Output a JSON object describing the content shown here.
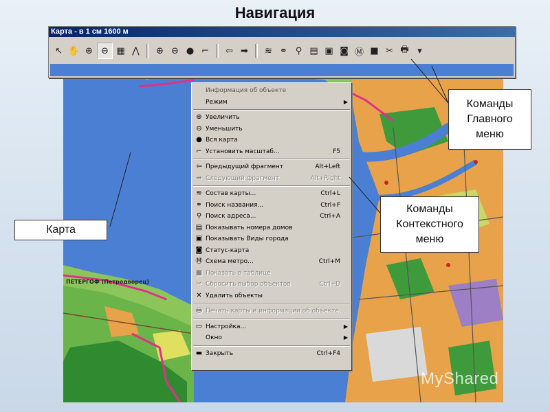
{
  "slide_title": "Навигация",
  "window": {
    "title": "Карта - в 1 см 1600 м"
  },
  "toolbar": {
    "buttons": [
      {
        "icon": "arrow-pointer-icon",
        "glyph": "↖"
      },
      {
        "icon": "hand-pan-icon",
        "glyph": "✋"
      },
      {
        "icon": "zoom-in-icon",
        "glyph": "⊕"
      },
      {
        "icon": "zoom-out-icon",
        "glyph": "⊖"
      },
      {
        "icon": "train-icon",
        "glyph": "▦"
      },
      {
        "icon": "compass-icon",
        "glyph": "⋀"
      },
      {
        "icon": "plus-circle-icon",
        "glyph": "⊕"
      },
      {
        "icon": "minus-circle-icon",
        "glyph": "⊖"
      },
      {
        "icon": "globe-icon",
        "glyph": "●"
      },
      {
        "icon": "scale-ruler-icon",
        "glyph": "⌐"
      },
      {
        "icon": "back-arrow-icon",
        "glyph": "⇦"
      },
      {
        "icon": "forward-arrow-icon",
        "glyph": "➡"
      },
      {
        "icon": "layers-icon",
        "glyph": "≋"
      },
      {
        "icon": "binoculars-icon",
        "glyph": "⚭"
      },
      {
        "icon": "address-search-icon",
        "glyph": "⚲"
      },
      {
        "icon": "house-numbers-icon",
        "glyph": "▤"
      },
      {
        "icon": "camera-icon",
        "glyph": "▣"
      },
      {
        "icon": "status-map-icon",
        "glyph": "◙"
      },
      {
        "icon": "metro-icon",
        "glyph": "Ⓜ"
      },
      {
        "icon": "table-icon",
        "glyph": "■"
      },
      {
        "icon": "deselect-icon",
        "glyph": "✂"
      },
      {
        "icon": "print-icon",
        "glyph": "🖶"
      },
      {
        "icon": "dropdown-arrow-icon",
        "glyph": "▾"
      }
    ]
  },
  "context_menu": {
    "items": [
      {
        "type": "item",
        "label": "Информация об объекте",
        "icon": "",
        "shortcut": "",
        "state": "header"
      },
      {
        "type": "item",
        "label": "Режим",
        "icon": "",
        "shortcut": "",
        "submenu": true
      },
      {
        "type": "sep"
      },
      {
        "type": "item",
        "label": "Увеличить",
        "icon": "⊕",
        "shortcut": ""
      },
      {
        "type": "item",
        "label": "Уменьшить",
        "icon": "⊖",
        "shortcut": ""
      },
      {
        "type": "item",
        "label": "Вся карта",
        "icon": "●",
        "shortcut": ""
      },
      {
        "type": "item",
        "label": "Установить масштаб...",
        "icon": "⌐",
        "shortcut": "F5"
      },
      {
        "type": "sep"
      },
      {
        "type": "item",
        "label": "Предыдущий фрагмент",
        "icon": "⇦",
        "shortcut": "Alt+Left"
      },
      {
        "type": "item",
        "label": "Следующий фрагмент",
        "icon": "➡",
        "shortcut": "Alt+Right",
        "state": "disabled"
      },
      {
        "type": "sep"
      },
      {
        "type": "item",
        "label": "Состав карты...",
        "icon": "≋",
        "shortcut": "Ctrl+L"
      },
      {
        "type": "item",
        "label": "Поиск названия...",
        "icon": "⚭",
        "shortcut": "Ctrl+F"
      },
      {
        "type": "item",
        "label": "Поиск адреса...",
        "icon": "⚲",
        "shortcut": "Ctrl+A"
      },
      {
        "type": "item",
        "label": "Показывать номера домов",
        "icon": "▤",
        "shortcut": ""
      },
      {
        "type": "item",
        "label": "Показывать Виды города",
        "icon": "▣",
        "shortcut": ""
      },
      {
        "type": "item",
        "label": "Статус-карта",
        "icon": "◙",
        "shortcut": ""
      },
      {
        "type": "item",
        "label": "Схема метро...",
        "icon": "Ⓜ",
        "shortcut": "Ctrl+M"
      },
      {
        "type": "item",
        "label": "Показать в таблице",
        "icon": "■",
        "shortcut": "",
        "state": "disabled"
      },
      {
        "type": "item",
        "label": "Сбросить выбор объектов",
        "icon": "✂",
        "shortcut": "Ctrl+D",
        "state": "disabled"
      },
      {
        "type": "item",
        "label": "Удалить объекты",
        "icon": "✕",
        "shortcut": ""
      },
      {
        "type": "sep"
      },
      {
        "type": "item",
        "label": "Печать карты и информации об объекте...",
        "icon": "🖶",
        "shortcut": "",
        "state": "disabled"
      },
      {
        "type": "sep"
      },
      {
        "type": "item",
        "label": "Настройка...",
        "icon": "▭",
        "shortcut": "",
        "submenu": true
      },
      {
        "type": "item",
        "label": "Окно",
        "icon": "",
        "shortcut": "",
        "submenu": true
      },
      {
        "type": "sep"
      },
      {
        "type": "item",
        "label": "Закрыть",
        "icon": "▬",
        "shortcut": "Ctrl+F4"
      }
    ]
  },
  "callouts": {
    "main_menu": "Команды Главного меню",
    "context_menu": "Команды Контекстного меню",
    "map": "Карта"
  },
  "map_labels": {
    "peterhof": "ПЕТЕРГОФ (Петродворец)"
  },
  "watermark": "MyShared",
  "colors": {
    "water": "#4a7fd4",
    "menu_bg": "#d4d0c8",
    "titlebar": "#0a246a",
    "land_orange": "#e8a24a",
    "land_green": "#3e9a3a",
    "boundary": "#e0308a"
  }
}
